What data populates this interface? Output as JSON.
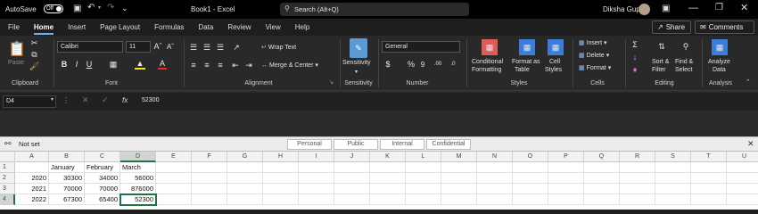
{
  "titlebar": {
    "autosave_label": "AutoSave",
    "autosave_state": "Off",
    "doc_title": "Book1 - Excel",
    "search_placeholder": "Search (Alt+Q)",
    "user_name": "Diksha Gupta"
  },
  "tabs": [
    "File",
    "Home",
    "Insert",
    "Page Layout",
    "Formulas",
    "Data",
    "Review",
    "View",
    "Help"
  ],
  "active_tab": "Home",
  "share_label": "Share",
  "comments_label": "Comments",
  "ribbon": {
    "clipboard": {
      "paste": "Paste",
      "label": "Clipboard"
    },
    "font": {
      "name": "Calibri",
      "size": "11",
      "label": "Font"
    },
    "alignment": {
      "wrap": "Wrap Text",
      "merge": "Merge & Center",
      "label": "Alignment"
    },
    "sensitivity": {
      "button": "Sensitivity",
      "label": "Sensitivity"
    },
    "number": {
      "format": "General",
      "label": "Number"
    },
    "styles": {
      "cond1": "Conditional",
      "cond2": "Formatting",
      "fmt1": "Format as",
      "fmt2": "Table",
      "cell1": "Cell",
      "cell2": "Styles",
      "label": "Styles"
    },
    "cells": {
      "insert": "Insert",
      "delete": "Delete",
      "format": "Format",
      "label": "Cells"
    },
    "editing": {
      "sort1": "Sort &",
      "sort2": "Filter",
      "find1": "Find &",
      "find2": "Select",
      "label": "Editing"
    },
    "analysis": {
      "btn1": "Analyze",
      "btn2": "Data",
      "label": "Analysis"
    }
  },
  "formula_bar": {
    "name_box": "D4",
    "fx": "fx",
    "value": "52300"
  },
  "sensitivity_bar": {
    "label": "Not set",
    "options": [
      "Personal",
      "Public",
      "Internal",
      "Confidential"
    ]
  },
  "sheet": {
    "columns": [
      "A",
      "B",
      "C",
      "D",
      "E",
      "F",
      "G",
      "H",
      "I",
      "J",
      "K",
      "L",
      "M",
      "N",
      "O",
      "P",
      "Q",
      "R",
      "S",
      "T",
      "U"
    ],
    "row_numbers": [
      "1",
      "2",
      "3",
      "4"
    ],
    "rows": [
      [
        "",
        "January",
        "February",
        "March"
      ],
      [
        "2020",
        "30300",
        "34000",
        "56000"
      ],
      [
        "2021",
        "70000",
        "70000",
        "876000"
      ],
      [
        "2022",
        "67300",
        "65400",
        "52300"
      ]
    ],
    "selected_cell": "D4"
  }
}
